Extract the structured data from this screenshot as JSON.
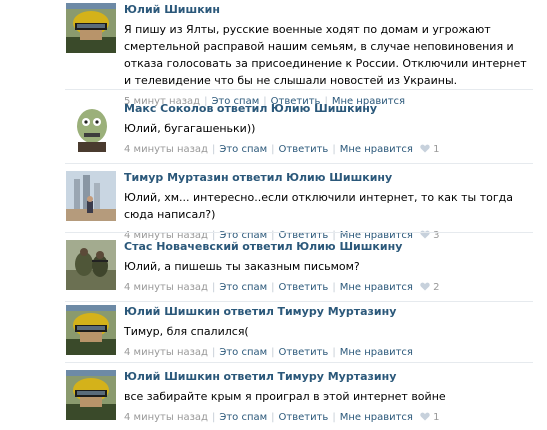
{
  "colors": {
    "link": "#2b587a",
    "meta": "#999999",
    "separator": "#e6eaee",
    "heart": "#c7d1dc"
  },
  "comments": [
    {
      "author": "Юлий Шишкин",
      "replied_word": "",
      "target": "",
      "text": "Я пишу из Ялты, русские военные ходят по домам и угрожают смертельной расправой нашим семьям, в случае неповиновения и отказа голосовать за присоединение к России. Отключили интернет и телевидение что бы не слышали новостей из Украины.",
      "time": "5 минут назад",
      "spam": "Это спам",
      "reply": "Ответить",
      "like": "Мне нравится",
      "likes": "",
      "avatar_icon": "soldier-helmet-avatar"
    },
    {
      "author": "Макс Соколов",
      "replied_word": "ответил",
      "target": "Юлию Шишкину",
      "text": "Юлий, бугагашеньки))",
      "time": "4 минуты назад",
      "spam": "Это спам",
      "reply": "Ответить",
      "like": "Мне нравится",
      "likes": "1",
      "avatar_icon": "zombie-face-avatar"
    },
    {
      "author": "Тимур Муртазин",
      "replied_word": "ответил",
      "target": "Юлию Шишкину",
      "text": "Юлий, хм... интересно..если отключили интернет, то как ты тогда сюда написал?)",
      "time": "4 минуты назад",
      "spam": "Это спам",
      "reply": "Ответить",
      "like": "Мне нравится",
      "likes": "3",
      "avatar_icon": "city-towers-avatar"
    },
    {
      "author": "Стас Новачевский",
      "replied_word": "ответил",
      "target": "Юлию Шишкину",
      "text": "Юлий, а пишешь ты заказным письмом?",
      "time": "4 минуты назад",
      "spam": "Это спам",
      "reply": "Ответить",
      "like": "Мне нравится",
      "likes": "2",
      "avatar_icon": "soldiers-field-avatar"
    },
    {
      "author": "Юлий Шишкин",
      "replied_word": "ответил",
      "target": "Тимуру Муртазину",
      "text": "Тимур, бля спалился(",
      "time": "4 минуты назад",
      "spam": "Это спам",
      "reply": "Ответить",
      "like": "Мне нравится",
      "likes": "",
      "avatar_icon": "soldier-helmet-avatar"
    },
    {
      "author": "Юлий Шишкин",
      "replied_word": "ответил",
      "target": "Тимуру Муртазину",
      "text": "все забирайте крым я проиграл в этой интернет войне",
      "time": "4 минуты назад",
      "spam": "Это спам",
      "reply": "Ответить",
      "like": "Мне нравится",
      "likes": "1",
      "avatar_icon": "soldier-helmet-avatar"
    }
  ]
}
